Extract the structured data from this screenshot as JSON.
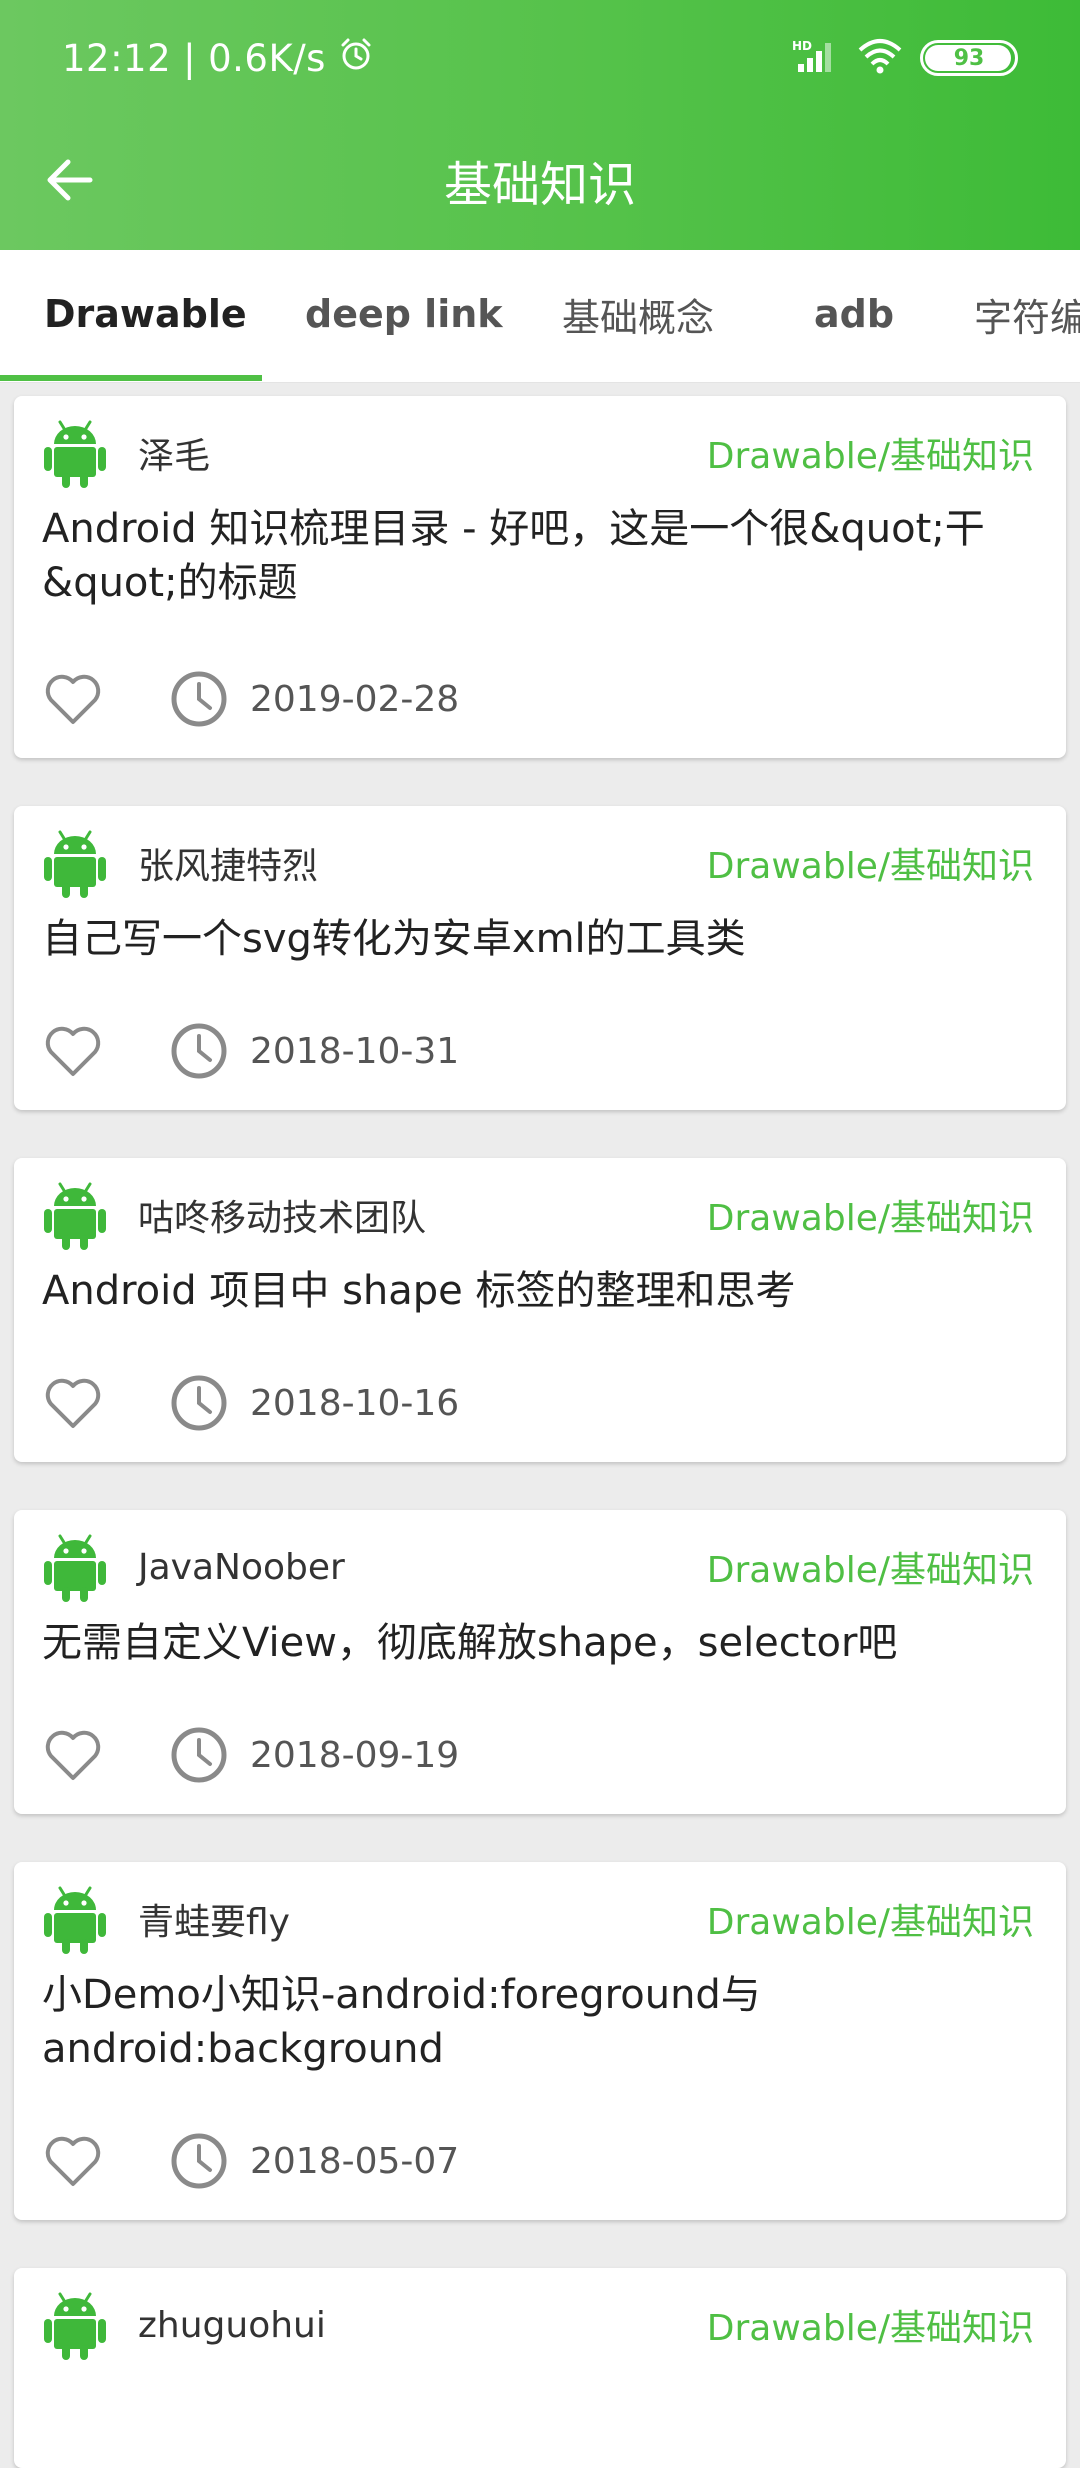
{
  "status": {
    "time": "12:12",
    "speed": "0.6K/s",
    "battery": "93",
    "network": "HD"
  },
  "toolbar": {
    "title": "基础知识"
  },
  "tabs": [
    "Drawable",
    "deep link",
    "基础概念",
    "adb",
    "字符编"
  ],
  "articles": [
    {
      "author": "泽毛",
      "chapter": "Drawable/基础知识",
      "title": "Android 知识梳理目录 - 好吧，这是一个很&quot;干&quot;的标题",
      "date": "2019-02-28"
    },
    {
      "author": "张风捷特烈",
      "chapter": "Drawable/基础知识",
      "title": "自己写一个svg转化为安卓xml的工具类",
      "date": "2018-10-31"
    },
    {
      "author": "咕咚移动技术团队",
      "chapter": "Drawable/基础知识",
      "title": "Android 项目中 shape 标签的整理和思考",
      "date": "2018-10-16"
    },
    {
      "author": "JavaNoober",
      "chapter": "Drawable/基础知识",
      "title": "无需自定义View，彻底解放shape，selector吧",
      "date": "2018-09-19"
    },
    {
      "author": "青蛙要fly",
      "chapter": "Drawable/基础知识",
      "title": "小Demo小知识-android:foreground与android:background",
      "date": "2018-05-07"
    },
    {
      "author": "zhuguohui",
      "chapter": "Drawable/基础知识",
      "title": "",
      "date": ""
    }
  ],
  "colors": {
    "primary": "#55c24a",
    "accent": "#4fbf44",
    "background": "#ececec"
  },
  "icons": [
    "back-arrow-icon",
    "alarm-icon",
    "signal-icon",
    "wifi-icon",
    "battery-icon",
    "android-icon",
    "heart-icon",
    "clock-icon"
  ]
}
